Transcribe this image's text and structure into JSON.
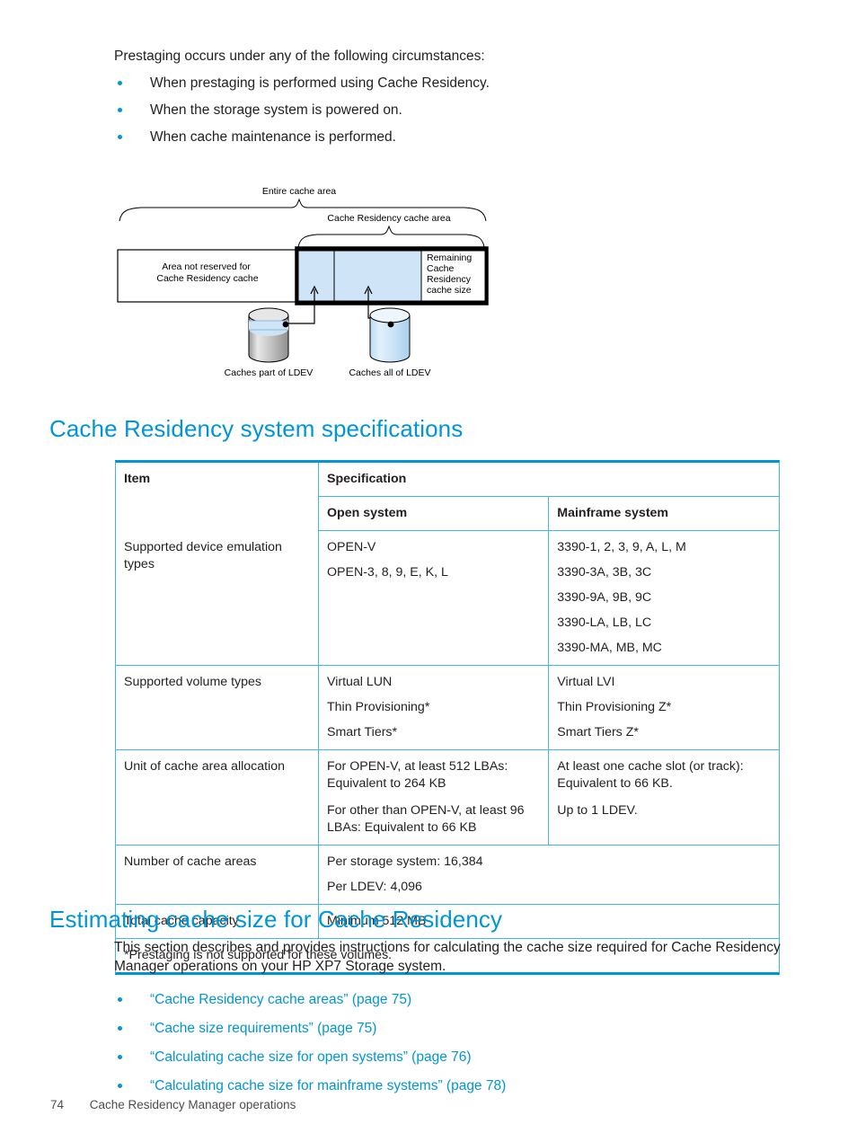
{
  "intro": {
    "lead": "Prestaging occurs under any of the following circumstances:",
    "bullets": [
      "When prestaging is performed using Cache Residency.",
      "When the storage system is powered on.",
      "When cache maintenance is performed."
    ]
  },
  "figure": {
    "brace_top_label": "Entire cache area",
    "brace_mid_label": "Cache Residency cache area",
    "bar_left_label_line1": "Area not reserved for",
    "bar_left_label_line2": "Cache Residency cache",
    "bar_right_label_line1": "Remaining",
    "bar_right_label_line2": "Cache",
    "bar_right_label_line3": "Residency",
    "bar_right_label_line4": "cache size",
    "cyl_left_caption": "Caches part of LDEV",
    "cyl_right_caption": "Caches all of LDEV",
    "colors": {
      "cache_fill": "#cfe5f7",
      "cylinder_gray": "#c8c8c8",
      "outline": "#000000"
    }
  },
  "headings": {
    "specs": "Cache Residency system specifications",
    "estimating": "Estimating cache size for Cache Residency"
  },
  "spec_table": {
    "header": {
      "item": "Item",
      "specification": "Specification",
      "open_system": "Open system",
      "mainframe_system": "Mainframe system"
    },
    "rows": [
      {
        "item": "Supported device emulation types",
        "open": [
          "OPEN-V",
          "OPEN-3, 8, 9, E, K, L"
        ],
        "mainframe": [
          "3390-1, 2, 3, 9, A, L, M",
          "3390-3A, 3B, 3C",
          "3390-9A, 9B, 9C",
          "3390-LA, LB, LC",
          "3390-MA, MB, MC"
        ]
      },
      {
        "item": "Supported volume types",
        "open": [
          "Virtual LUN",
          "Thin Provisioning*",
          "Smart Tiers*"
        ],
        "mainframe": [
          "Virtual LVI",
          "Thin Provisioning Z*",
          "Smart Tiers Z*"
        ]
      },
      {
        "item": "Unit of cache area allocation",
        "open": [
          "For OPEN-V, at least 512 LBAs: Equivalent to 264 KB",
          "For other than OPEN-V, at least 96 LBAs: Equivalent to 66 KB"
        ],
        "mainframe": [
          "At least one cache slot (or track): Equivalent to 66 KB.",
          "Up to 1 LDEV."
        ]
      }
    ],
    "row_cache_areas": {
      "item": "Number of cache areas",
      "value": [
        "Per storage system: 16,384",
        "Per LDEV: 4,096"
      ]
    },
    "row_total_capacity": {
      "item": "Total cache capacity",
      "value": "Minimum 512 MB"
    },
    "footnote": "*Prestaging is not supported for these volumes.",
    "colors": {
      "border_heavy": "#0096d6",
      "border_light": "#41b6e6"
    }
  },
  "estimating": {
    "paragraph": "This section describes and provides instructions for calculating the cache size required for Cache Residency Manager operations on your HP XP7 Storage system.",
    "links": [
      "“Cache Residency cache areas” (page 75)",
      "“Cache size requirements” (page 75)",
      "“Calculating cache size for open systems” (page 76)",
      "“Calculating cache size for mainframe systems” (page 78)"
    ]
  },
  "footer": {
    "page_number": "74",
    "title": "Cache Residency Manager operations"
  },
  "theme": {
    "accent_blue": "#0096d6",
    "text_black": "#231f20"
  }
}
